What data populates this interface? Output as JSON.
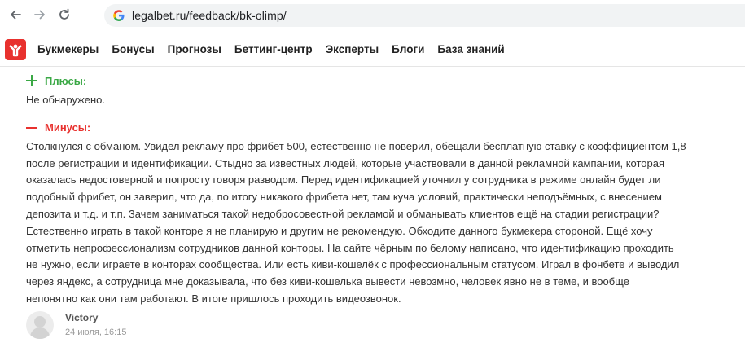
{
  "browser": {
    "url": "legalbet.ru/feedback/bk-olimp/",
    "icons": [
      "back-arrow-icon",
      "forward-arrow-icon",
      "reload-icon",
      "google-icon"
    ]
  },
  "site": {
    "brand_color": "#e8312e",
    "menu": [
      {
        "label": "Букмекеры"
      },
      {
        "label": "Бонусы"
      },
      {
        "label": "Прогнозы"
      },
      {
        "label": "Беттинг-центр"
      },
      {
        "label": "Эксперты"
      },
      {
        "label": "Блоги"
      },
      {
        "label": "База знаний"
      }
    ]
  },
  "review": {
    "pros_title": "Плюсы:",
    "pros_text": "Не обнаружено.",
    "pros_color": "#3aa845",
    "cons_title": "Минусы:",
    "cons_color": "#e8312e",
    "cons_lines": [
      "Столкнулся с обманом. Увидел рекламу про фрибет 500, естественно не поверил, обещали бесплатную ставку с коэффициентом 1,8",
      "после регистрации и идентификации. Стыдно за известных людей, которые участвовали в данной рекламной кампании, которая",
      "оказалась недостоверной и попросту говоря разводом. Перед идентификацией уточнил у сотрудника в режиме онлайн будет ли",
      "подобный фрибет, он заверил, что да, по итогу никакого фрибета нет, там куча условий, практически неподъёмных, с внесением",
      "депозита и т.д. и т.п. Зачем заниматься такой недобросовестной рекламой и обманывать клиентов ещё на стадии регистрации?",
      "Естественно играть в такой конторе я не планирую и другим не рекомендую. Обходите данного букмекера стороной. Ещё хочу",
      "отметить непрофессионализм сотрудников данной конторы. На сайте чёрным по белому написано, что идентификацию проходить",
      "не нужно, если играете в конторах сообщества. Или есть киви-кошелёк с профессиональным статусом. Играл в фонбете и выводил",
      "через яндекс, а сотрудница мне доказывала, что без киви-кошелька вывести невозмно, человек явно не в теме, и вообще",
      "непонятно как они там работают. В итоге пришлось проходить видеозвонок."
    ]
  },
  "author": {
    "name": "Victory",
    "date": "24 июля, 16:15"
  }
}
